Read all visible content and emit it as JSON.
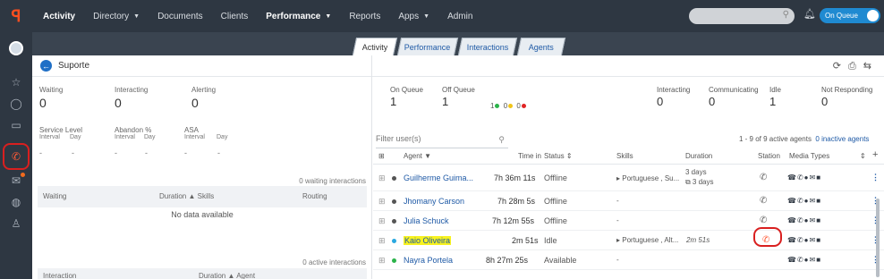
{
  "nav": {
    "items": [
      {
        "label": "Activity",
        "bold": true,
        "caret": false
      },
      {
        "label": "Directory",
        "bold": false,
        "caret": true
      },
      {
        "label": "Documents",
        "bold": false,
        "caret": false
      },
      {
        "label": "Clients",
        "bold": false,
        "caret": false
      },
      {
        "label": "Performance",
        "bold": true,
        "caret": true
      },
      {
        "label": "Reports",
        "bold": false,
        "caret": false
      },
      {
        "label": "Apps",
        "bold": false,
        "caret": true
      },
      {
        "label": "Admin",
        "bold": false,
        "caret": false
      }
    ],
    "queue_toggle": "On Queue"
  },
  "tabs": [
    "Activity",
    "Performance",
    "Interactions",
    "Agents"
  ],
  "active_tab": "Activity",
  "page_title": "Suporte",
  "left": {
    "waiting": {
      "label": "Waiting",
      "value": "0"
    },
    "interacting": {
      "label": "Interacting",
      "value": "0"
    },
    "alerting": {
      "label": "Alerting",
      "value": "0"
    },
    "service_level": {
      "label": "Service Level",
      "sub1": "Interval",
      "sub2": "Day"
    },
    "abandon": {
      "label": "Abandon %",
      "sub1": "Interval",
      "sub2": "Day"
    },
    "asa": {
      "label": "ASA",
      "sub1": "Interval",
      "sub2": "Day"
    },
    "dash": "-",
    "waiting_count": "0 waiting interactions",
    "waiting_cols": {
      "waiting": "Waiting",
      "duration": "Duration",
      "skills": "Skills",
      "routing": "Routing"
    },
    "no_data": "No data available",
    "active_count": "0 active interactions",
    "active_cols": {
      "interaction": "Interaction",
      "duration": "Duration",
      "agent": "Agent"
    }
  },
  "right": {
    "on_queue": {
      "label": "On Queue",
      "value": "1"
    },
    "off_queue": {
      "label": "Off Queue",
      "value": "1"
    },
    "dots": {
      "green": "1",
      "yellow": "0",
      "red": "0"
    },
    "interacting": {
      "label": "Interacting",
      "value": "0"
    },
    "communicating": {
      "label": "Communicating",
      "value": "0"
    },
    "idle": {
      "label": "Idle",
      "value": "1"
    },
    "not_responding": {
      "label": "Not Responding",
      "value": "0"
    },
    "filter_placeholder": "Filter user(s)",
    "active_agents": "1 - 9 of 9 active agents",
    "inactive_agents": "0 inactive agents",
    "columns": {
      "agent": "Agent",
      "time_in": "Time in",
      "status": "Status",
      "skills": "Skills",
      "duration": "Duration",
      "station": "Station",
      "media": "Media Types"
    },
    "rows": [
      {
        "name": "Guilherme Guima...",
        "dot": "#555555",
        "time": "7h 36m 11s",
        "status": "Offline",
        "skills": "▸ Portuguese , Su...",
        "duration": "3 days",
        "duration2": "⧉ 3 days",
        "highlight": false
      },
      {
        "name": "Jhomany Carson",
        "dot": "#555555",
        "time": "7h 28m 5s",
        "status": "Offline",
        "skills": "-",
        "duration": "",
        "duration2": "",
        "highlight": false
      },
      {
        "name": "Julia Schuck",
        "dot": "#555555",
        "time": "7h 12m 55s",
        "status": "Offline",
        "skills": "-",
        "duration": "",
        "duration2": "",
        "highlight": false
      },
      {
        "name": "Kaio Oliveira",
        "dot": "#2aa8e0",
        "time": "2m 51s",
        "status": "Idle",
        "skills": "▸ Portuguese , Alt...",
        "duration": "2m 51s",
        "duration2": "",
        "highlight": true
      },
      {
        "name": "Nayra Portela",
        "dot": "#2bb34a",
        "time": "8h 27m 25s",
        "status": "Available",
        "skills": "-",
        "duration": "",
        "duration2": "",
        "highlight": false
      }
    ]
  }
}
